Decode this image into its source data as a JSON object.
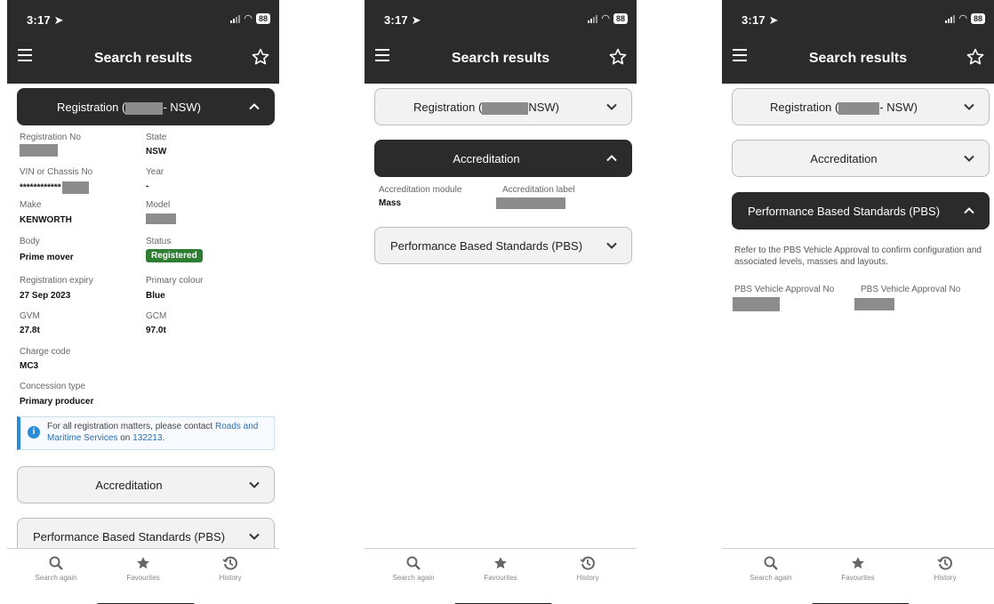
{
  "status_bar": {
    "time": "3:17",
    "battery": "88"
  },
  "app_bar": {
    "title": "Search results"
  },
  "bottom_nav": {
    "items": [
      {
        "label": "Search again"
      },
      {
        "label": "Favourites"
      },
      {
        "label": "History"
      }
    ]
  },
  "sections": {
    "registration_prefix": "Registration (",
    "registration_suffix": "- NSW)",
    "registration_suffix_nodash": "NSW)",
    "accreditation": "Accreditation",
    "pbs": "Performance Based Standards (PBS)"
  },
  "registration": {
    "fields": {
      "reg_no_label": "Registration No",
      "state_label": "State",
      "state_value": "NSW",
      "vin_label": "VIN or Chassis No",
      "vin_masked": "************",
      "year_label": "Year",
      "year_value": "-",
      "make_label": "Make",
      "make_value": "KENWORTH",
      "model_label": "Model",
      "body_label": "Body",
      "body_value": "Prime mover",
      "status_label": "Status",
      "status_value": "Registered",
      "expiry_label": "Registration expiry",
      "expiry_value": "27 Sep 2023",
      "colour_label": "Primary colour",
      "colour_value": "Blue",
      "gvm_label": "GVM",
      "gvm_value": "27.8t",
      "gcm_label": "GCM",
      "gcm_value": "97.0t",
      "charge_label": "Charge code",
      "charge_value": "MC3",
      "concession_label": "Concession type",
      "concession_value": "Primary producer"
    },
    "info": {
      "text_prefix": "For all registration matters, please contact ",
      "link": "Roads and Maritime Services",
      "text_mid": " on ",
      "phone": "132213",
      "text_suffix": "."
    }
  },
  "accreditation": {
    "module_label": "Accreditation module",
    "module_value": "Mass",
    "label_label": "Accreditation label"
  },
  "pbs": {
    "paragraph": "Refer to the PBS Vehicle Approval to confirm configuration and associated levels, masses and layouts.",
    "approval_label_1": "PBS Vehicle Approval No",
    "approval_label_2": "PBS Vehicle Approval No"
  },
  "colors": {
    "header_bg": "#2b2b2b",
    "status_green": "#2e7d32",
    "info_blue": "#2a8bd6",
    "link_blue": "#2a6fb2",
    "redaction": "#8c8c8c"
  },
  "icons": [
    "menu-icon",
    "star-icon",
    "chevron-up-icon",
    "chevron-down-icon",
    "info-icon",
    "search-icon",
    "history-icon"
  ]
}
